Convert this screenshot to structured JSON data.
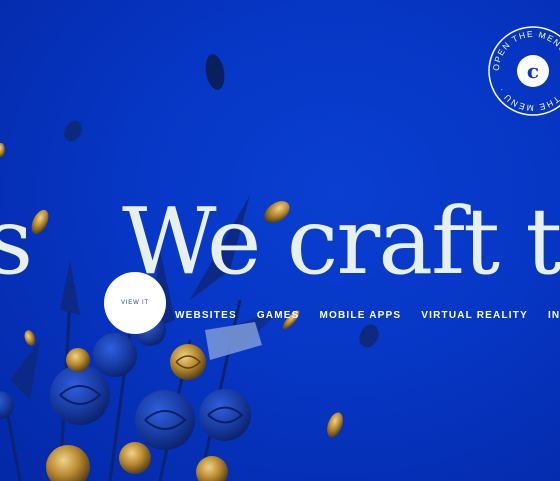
{
  "hero": {
    "left_fragment": "s",
    "headline": "We craft tou"
  },
  "view_button": {
    "label": "VIEW IT"
  },
  "categories": [
    "WEBSITES",
    "GAMES",
    "MOBILE APPS",
    "VIRTUAL REALITY",
    "INTERACT"
  ],
  "menu_badge": {
    "letter": "c",
    "ring_text": "OPEN THE MENU · OPEN THE MENU · "
  },
  "colors": {
    "background": "#0636c4",
    "headline": "#e8f0ec",
    "gold": "#c9a24a"
  }
}
